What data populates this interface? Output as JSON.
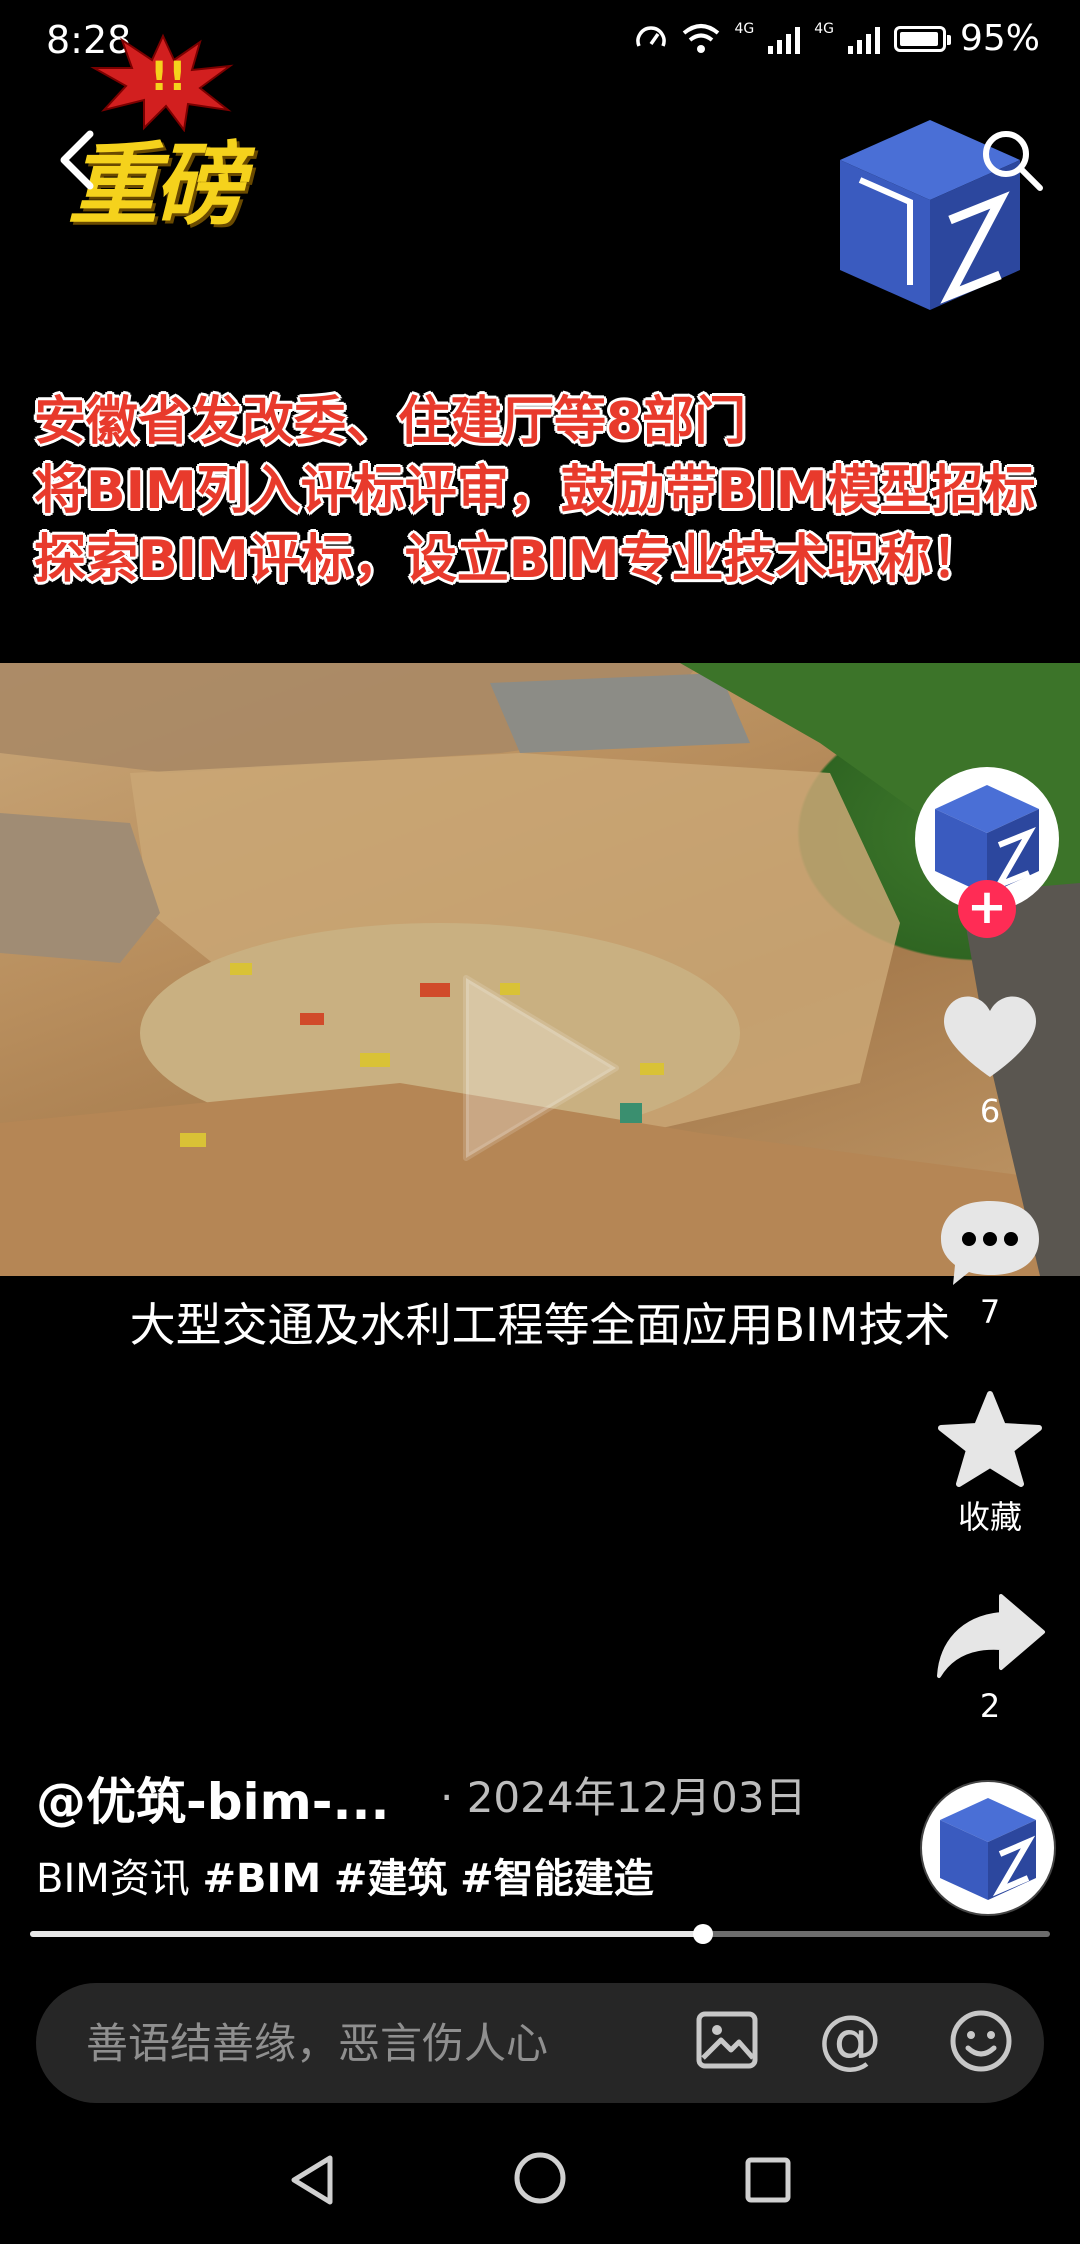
{
  "status_bar": {
    "time": "8:28",
    "network_1": "4G",
    "network_2": "4G",
    "battery": "95%"
  },
  "top": {
    "logo_text": "重磅"
  },
  "headline": {
    "lines": [
      "安徽省发改委、住建厅等8部门",
      "将BIM列入评标评审，鼓励带BIM模型招标",
      "探索BIM评标，设立BIM专业技术职称！"
    ],
    "color": "#e83a2c"
  },
  "video": {
    "subtitle": "大型交通及水利工程等全面应用BIM技术",
    "progress": 0.66
  },
  "rail": {
    "like_count": "6",
    "comment_count": "7",
    "favorite_label": "收藏",
    "share_count": "2"
  },
  "post": {
    "author": "@优筑-bim-...",
    "date": "· 2024年12月03日",
    "caption_prefix": "BIM资讯",
    "tags": [
      "#BIM",
      "#建筑",
      "#智能建造"
    ]
  },
  "comment_bar": {
    "placeholder": "善语结善缘，恶言伤人心",
    "at_symbol": "@"
  },
  "colors": {
    "accent_red": "#ff2c55",
    "logo_yellow": "#f5d21c",
    "cube_blue": "#3a5bbf"
  }
}
